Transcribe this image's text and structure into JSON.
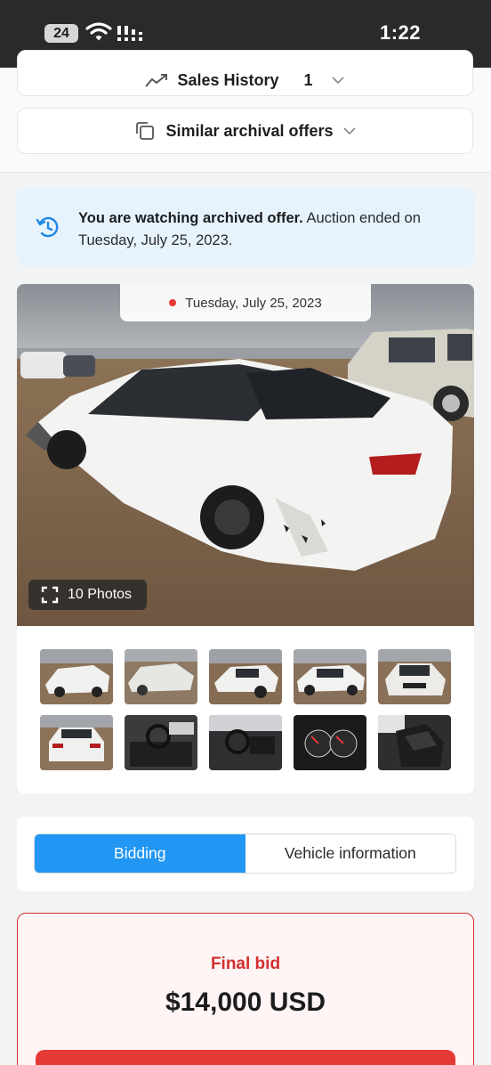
{
  "status_bar": {
    "battery": "24",
    "time": "1:22"
  },
  "accordions": {
    "sales_history_label": "Sales History",
    "sales_history_count": "1",
    "similar_offers_label": "Similar archival offers"
  },
  "notice": {
    "bold": "You are watching archived offer.",
    "rest": " Auction ended on Tuesday, July 25, 2023."
  },
  "gallery": {
    "date": "Tuesday, July 25, 2023",
    "photos_button": "10 Photos",
    "thumbnail_count": 10
  },
  "tabs": [
    {
      "label": "Bidding",
      "active": true
    },
    {
      "label": "Vehicle information",
      "active": false
    }
  ],
  "bid": {
    "label": "Final bid",
    "value": "$14,000 USD"
  },
  "colors": {
    "accent": "#2196f3",
    "notice_bg": "#e6f3fd",
    "bid_red": "#d32f2f"
  }
}
